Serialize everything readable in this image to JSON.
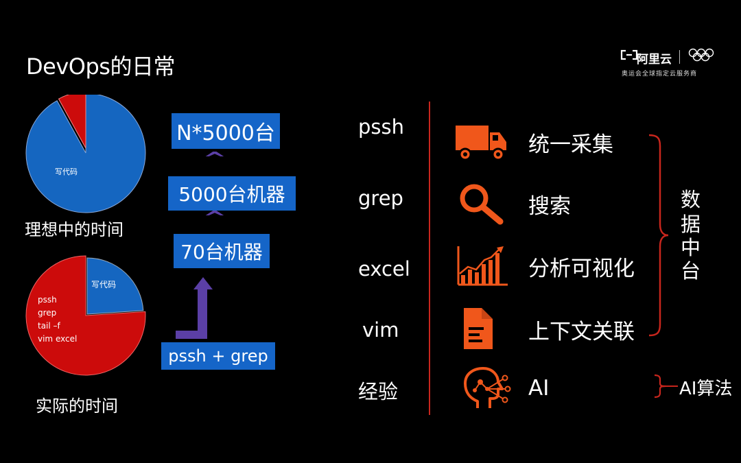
{
  "title": "DevOps的日常",
  "logo": {
    "name": "阿里云",
    "subtitle": "奥运会全球指定云服务商"
  },
  "pies": {
    "ideal": {
      "caption": "理想中的时间",
      "blue_label": "写代码",
      "blue_fraction": 0.92
    },
    "actual": {
      "caption": "实际的时间",
      "blue_label": "写代码",
      "blue_fraction": 0.2,
      "red_lines": [
        "pssh",
        "grep",
        "tail –f",
        "vim excel"
      ]
    }
  },
  "scale_boxes": {
    "top": "N*5000台",
    "middle": "5000台机器",
    "bottom": "70台机器",
    "base": "pssh + grep"
  },
  "tools": [
    "pssh",
    "grep",
    "excel",
    "vim",
    "经验"
  ],
  "features": [
    {
      "label": "统一采集",
      "icon": "truck-icon"
    },
    {
      "label": "搜索",
      "icon": "search-icon"
    },
    {
      "label": "分析可视化",
      "icon": "chart-icon"
    },
    {
      "label": "上下文关联",
      "icon": "document-icon"
    },
    {
      "label": "AI",
      "icon": "ai-head-icon"
    }
  ],
  "group_label": [
    "数",
    "据",
    "中",
    "台"
  ],
  "ai_group_label": "AI算法",
  "colors": {
    "background": "#000000",
    "accent_orange": "#f0571b",
    "box_blue": "#1565c8",
    "pie_blue": "#1566c0",
    "pie_red": "#cc0b0b",
    "bracket_red": "#c8261d",
    "arrow_purple": "#5b3fa6"
  }
}
